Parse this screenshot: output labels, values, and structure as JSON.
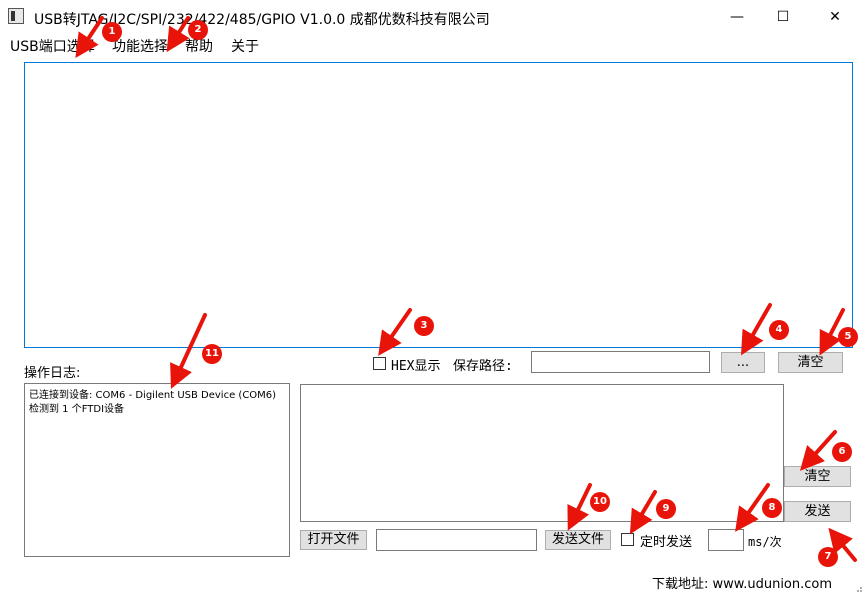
{
  "window": {
    "title": "USB转JTAG/I2C/SPI/232/422/485/GPIO  V1.0.0    成都优数科技有限公司",
    "minimize_glyph": "—",
    "maximize_glyph": "☐",
    "close_glyph": "✕"
  },
  "menu": {
    "items": [
      {
        "label": "USB端口选择"
      },
      {
        "label": "功能选择"
      },
      {
        "label": "帮助"
      },
      {
        "label": "关于"
      }
    ]
  },
  "log": {
    "label": "操作日志:",
    "lines": [
      "已连接到设备: COM6 - Digilent USB Device (COM6)",
      "检测到 1 个FTDI设备"
    ]
  },
  "receive_controls": {
    "hex_display_label": "HEX显示",
    "save_path_label": "保存路径:",
    "save_path_value": "",
    "browse_label": "...",
    "clear_label": "清空"
  },
  "send_controls": {
    "clear_label": "清空",
    "send_label": "发送",
    "open_file_label": "打开文件",
    "file_path_value": "",
    "send_file_label": "发送文件",
    "timed_send_label": "定时发送",
    "interval_value": "",
    "interval_unit": "ms/次"
  },
  "footer": {
    "download_text": "下载地址:  www.udunion.com"
  },
  "annotations": {
    "color": "#e8140a",
    "markers": [
      "1",
      "2",
      "3",
      "4",
      "5",
      "6",
      "7",
      "8",
      "9",
      "10",
      "11"
    ]
  }
}
